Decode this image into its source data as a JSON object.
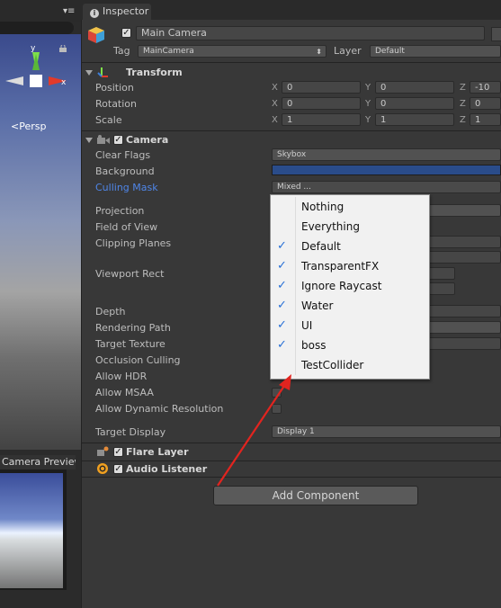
{
  "scene": {
    "menu_icon": "▾≡",
    "persp_label": "<Persp",
    "gizmo_y": "y",
    "gizmo_x": "x",
    "preview_title": "Camera Preview"
  },
  "inspector": {
    "tab_label": "Inspector",
    "object_name": "Main Camera",
    "tag_label": "Tag",
    "tag_value": "MainCamera",
    "layer_label": "Layer",
    "layer_value": "Default"
  },
  "transform": {
    "title": "Transform",
    "rows": [
      {
        "label": "Position",
        "x": "0",
        "y": "0",
        "z": "-10"
      },
      {
        "label": "Rotation",
        "x": "0",
        "y": "0",
        "z": "0"
      },
      {
        "label": "Scale",
        "x": "1",
        "y": "1",
        "z": "1"
      }
    ]
  },
  "camera": {
    "title": "Camera",
    "clear_flags_label": "Clear Flags",
    "clear_flags_value": "Skybox",
    "background_label": "Background",
    "background_color": "#2a4c8a",
    "culling_mask_label": "Culling Mask",
    "culling_mask_value": "Mixed ...",
    "projection_label": "Projection",
    "fov_label": "Field of View",
    "clipping_label": "Clipping Planes",
    "viewport_label": "Viewport Rect",
    "depth_label": "Depth",
    "rendering_path_label": "Rendering Path",
    "target_texture_label": "Target Texture",
    "occlusion_label": "Occlusion Culling",
    "allow_hdr_label": "Allow HDR",
    "allow_msaa_label": "Allow MSAA",
    "allow_dynamic_label": "Allow Dynamic Resolution",
    "target_display_label": "Target Display",
    "target_display_value": "Display 1"
  },
  "popup": {
    "items": [
      {
        "label": "Nothing",
        "checked": false
      },
      {
        "label": "Everything",
        "checked": false
      },
      {
        "label": "Default",
        "checked": true
      },
      {
        "label": "TransparentFX",
        "checked": true
      },
      {
        "label": "Ignore Raycast",
        "checked": true
      },
      {
        "label": "Water",
        "checked": true
      },
      {
        "label": "UI",
        "checked": true
      },
      {
        "label": "boss",
        "checked": true
      },
      {
        "label": "TestCollider",
        "checked": false
      }
    ]
  },
  "flare_layer": {
    "title": "Flare Layer"
  },
  "audio_listener": {
    "title": "Audio Listener"
  },
  "add_component_label": "Add Component",
  "colors": {
    "accent_label": "#4f86e8",
    "annotation_arrow": "#e2241f",
    "check_blue": "#2870d6"
  }
}
